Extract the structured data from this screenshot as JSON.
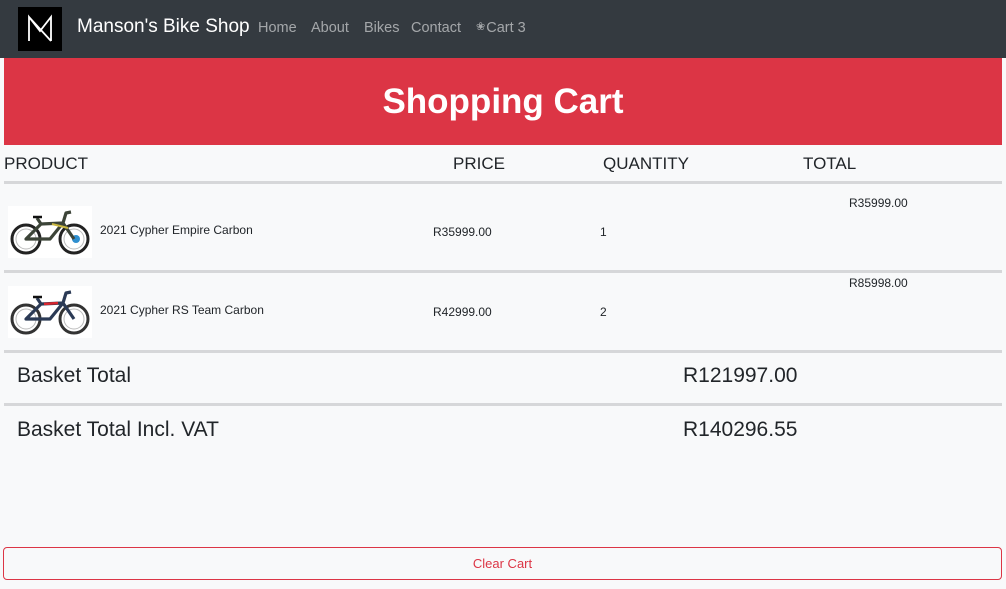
{
  "navbar": {
    "brand": "Manson's Bike Shop",
    "links": {
      "home": "Home",
      "about": "About",
      "bikes": "Bikes",
      "contact": "Contact"
    },
    "cart": {
      "icon": "basket-icon",
      "label": "Cart",
      "count": "3"
    }
  },
  "hero": {
    "title": "Shopping Cart"
  },
  "table": {
    "headers": {
      "product": "PRODUCT",
      "price": "PRICE",
      "quantity": "QUANTITY",
      "total": "TOTAL"
    },
    "items": [
      {
        "name": "2021 Cypher Empire Carbon",
        "price": "R35999.00",
        "quantity": "1",
        "total": "R35999.00",
        "image": "bike-image"
      },
      {
        "name": "2021 Cypher RS Team Carbon",
        "price": "R42999.00",
        "quantity": "2",
        "total": "R85998.00",
        "image": "bike-image"
      }
    ]
  },
  "summary": {
    "basket_total_label": "Basket Total",
    "basket_total_value": "R121997.00",
    "vat_total_label": "Basket Total Incl. VAT",
    "vat_total_value": "R140296.55"
  },
  "actions": {
    "clear_cart": "Clear Cart"
  },
  "colors": {
    "navbar": "#343a40",
    "hero": "#dc3545",
    "danger": "#dc3545",
    "background": "#f8f9fa"
  }
}
